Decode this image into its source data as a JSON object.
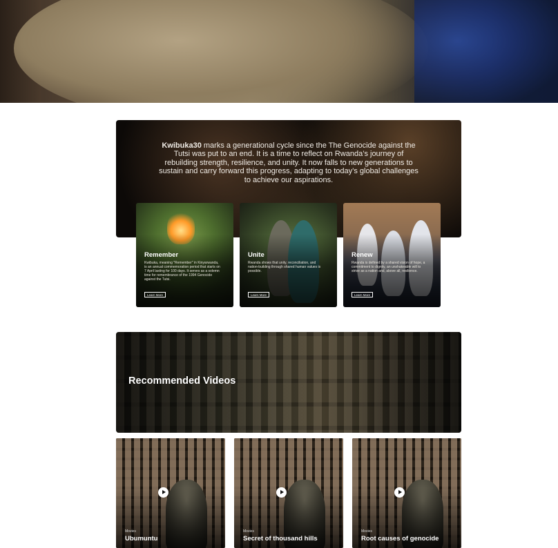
{
  "intro": {
    "highlight": "Kwibuka30",
    "text": " marks a generational cycle since the The Genocide against the Tutsi was put to an end. It is a time to reflect on Rwanda’s journey of rebuilding strength, resilience, and unity.  It now falls to new generations to sustain and carry forward this progress, adapting to today’s global challenges to achieve our aspirations."
  },
  "cards": [
    {
      "title": "Remember",
      "description": "Kwibuka, meaning \"Remember\" in Kinyarwanda, is an annual commemoration period that starts on 7 April lasting for 100 days. It serves as a solemn time for remembrance of the 1994 Genocide against the Tutsi.",
      "button": "Learn More"
    },
    {
      "title": "Unite",
      "description": "Rwanda shows that unity, reconciliation, and nation-building through shared human values is possible.",
      "button": "Learn More"
    },
    {
      "title": "Renew",
      "description": "Rwanda is defined by a shared  vision of hope, a commitment to dignity, an unshakeable will to strive as a nation and, above all, resilience.",
      "button": "Learn More"
    }
  ],
  "recommended": {
    "heading": "Recommended Videos"
  },
  "videos": [
    {
      "category": "Movies",
      "title": "Ubumuntu"
    },
    {
      "category": "Movies",
      "title": "Secret of thousand hills"
    },
    {
      "category": "Movies",
      "title": "Root causes of genocide"
    }
  ]
}
